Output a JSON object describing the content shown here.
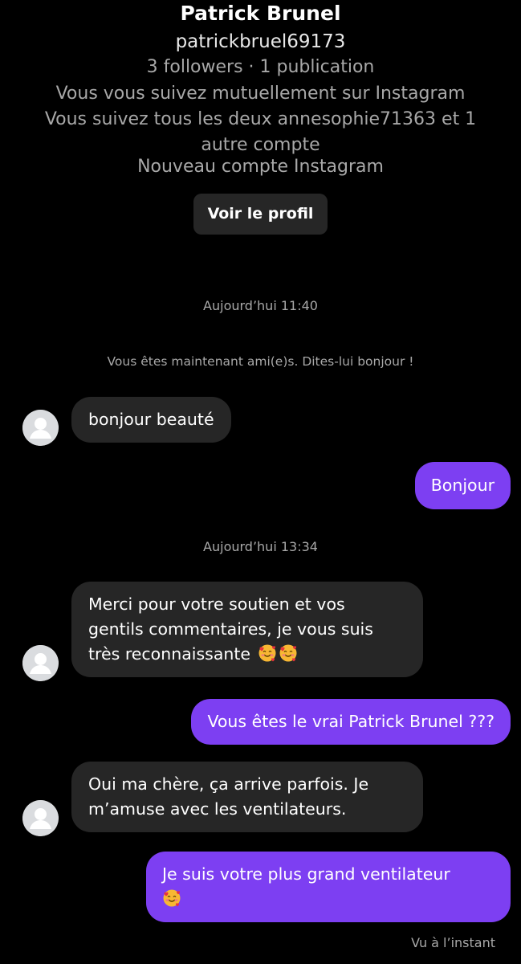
{
  "profile": {
    "name": "Patrick Brunel",
    "handle": "patrickbruel69173",
    "stats": "3 followers · 1 publication",
    "mutual": "Vous vous suivez mutuellement sur Instagram",
    "common_line1": "Vous suivez tous les deux annesophie71363 et 1",
    "common_line2": "autre compte",
    "new_account": "Nouveau compte Instagram",
    "view_profile_label": "Voir le profil"
  },
  "thread": {
    "timestamp1": "Aujourd’hui 11:40",
    "friend_notice": "Vous êtes maintenant ami(e)s. Dites-lui bonjour !",
    "msg1": "bonjour beauté",
    "msg2": "Bonjour",
    "timestamp2": "Aujourd’hui 13:34",
    "msg3_line1": "Merci pour votre soutien et vos",
    "msg3_line2": "gentils commentaires, je vous suis",
    "msg3_line3": "très reconnaissante",
    "msg4": "Vous êtes le vrai Patrick Brunel ???",
    "msg5_line1": "Oui ma chère, ça arrive parfois. Je",
    "msg5_line2": "m’amuse avec les ventilateurs.",
    "msg6_line1": "Je suis votre plus grand ventilateur",
    "seen_status": "Vu à l’instant"
  },
  "colors": {
    "background": "#000000",
    "incoming_bubble": "#262626",
    "outgoing_bubble": "#7d3ff2",
    "secondary_text": "#a8a8a8"
  },
  "icons": {
    "avatar": "default-avatar-icon",
    "emoji": "smiling-face-with-hearts-icon"
  }
}
